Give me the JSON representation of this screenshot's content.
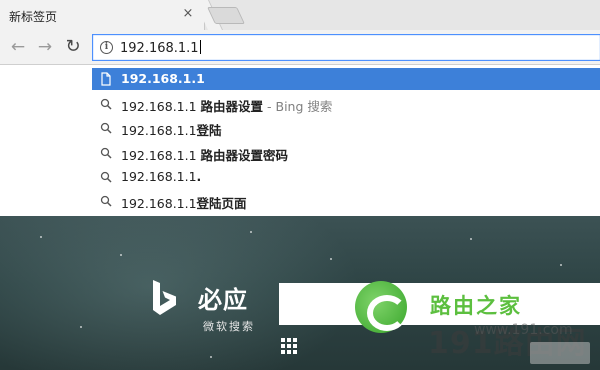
{
  "tab": {
    "title": "新标签页",
    "close_glyph": "×"
  },
  "toolbar": {
    "back_glyph": "←",
    "forward_glyph": "→",
    "reload_glyph": "↻",
    "info_glyph": "i",
    "url": "192.168.1.1"
  },
  "suggestions": [
    {
      "icon": "page-icon",
      "prefix": "192.168.1.1",
      "bold": "",
      "hint": "",
      "selected": true
    },
    {
      "icon": "search-icon",
      "prefix": "192.168.1.1 ",
      "bold": "路由器设置",
      "hint": " - Bing 搜索",
      "selected": false
    },
    {
      "icon": "search-icon",
      "prefix": "192.168.1.1",
      "bold": "登陆",
      "hint": "",
      "selected": false
    },
    {
      "icon": "search-icon",
      "prefix": "192.168.1.1 ",
      "bold": "路由器设置密码",
      "hint": "",
      "selected": false
    },
    {
      "icon": "search-icon",
      "prefix": "192.168.1.1",
      "bold": ".",
      "hint": "",
      "selected": false
    },
    {
      "icon": "search-icon",
      "prefix": "192.168.1.1",
      "bold": "登陆页面",
      "hint": "",
      "selected": false
    }
  ],
  "bing": {
    "name": "必应",
    "subtitle": "微软搜索"
  },
  "watermark": {
    "title": "路由之家",
    "domain": "www.191.com",
    "big": "191路由网"
  },
  "colors": {
    "accent": "#3d80d9",
    "focus": "#4d90fe",
    "watermark_green": "#5cbf3f"
  }
}
